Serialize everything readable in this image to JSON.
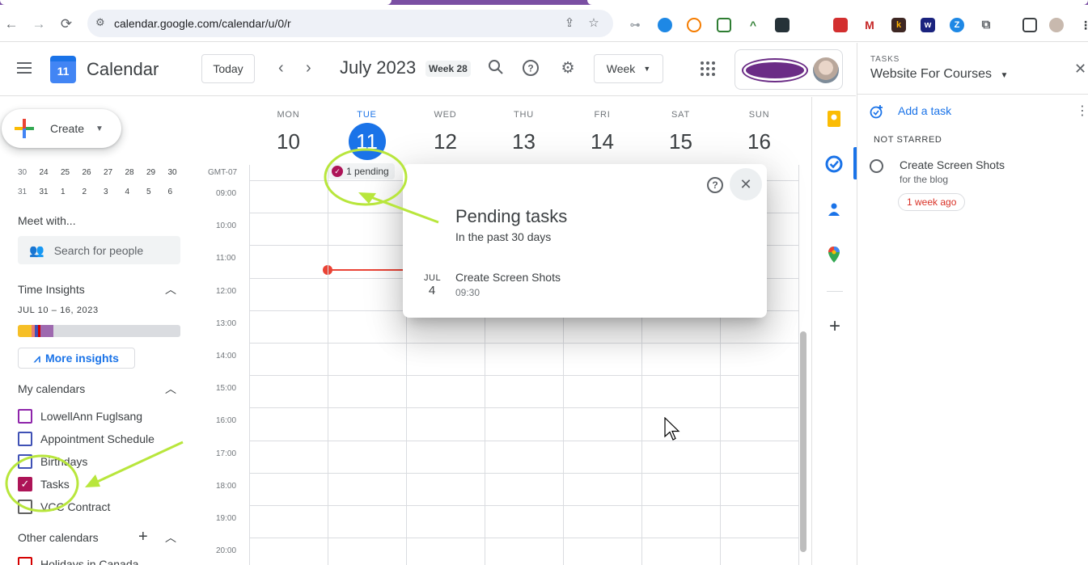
{
  "browser": {
    "url": "calendar.google.com/calendar/u/0/r"
  },
  "header": {
    "app_title": "Calendar",
    "logo_day": "11",
    "today_label": "Today",
    "prev_icon": "chevron-left-icon",
    "next_icon": "chevron-right-icon",
    "month_title": "July 2023",
    "week_badge": "Week 28",
    "view_label": "Week"
  },
  "sidebar": {
    "create_label": "Create",
    "mini_calendar": {
      "rows": [
        [
          "30",
          "24",
          "25",
          "26",
          "27",
          "28",
          "29",
          "30"
        ],
        [
          "31",
          "31",
          "1",
          "2",
          "3",
          "4",
          "5",
          "6"
        ]
      ]
    },
    "meet_with": {
      "title": "Meet with...",
      "search_placeholder": "Search for people"
    },
    "time_insights": {
      "title": "Time Insights",
      "date_range": "JUL 10 – 16, 2023",
      "bar_segments": [
        {
          "color": "#f6bf26",
          "fraction": 0.085
        },
        {
          "color": "#e67c73",
          "fraction": 0.02
        },
        {
          "color": "#3f51b5",
          "fraction": 0.02
        },
        {
          "color": "#d50000",
          "fraction": 0.015
        },
        {
          "color": "#9e69af",
          "fraction": 0.08
        }
      ],
      "more_label": "More insights"
    },
    "my_calendars": {
      "title": "My calendars",
      "items": [
        {
          "label": "LowellAnn Fuglsang",
          "color": "#8e24aa",
          "checked": false
        },
        {
          "label": "Appointment Schedule",
          "color": "#3f51b5",
          "checked": false
        },
        {
          "label": "Birthdays",
          "color": "#3f51b5",
          "checked": false
        },
        {
          "label": "Tasks",
          "color": "#ad1457",
          "checked": true
        },
        {
          "label": "VCC Contract",
          "color": "#616161",
          "checked": false
        }
      ]
    },
    "other_calendars": {
      "title": "Other calendars",
      "items": [
        {
          "label": "Holidays in Canada",
          "color": "#d50000"
        }
      ]
    }
  },
  "week": {
    "timezone": "GMT-07",
    "days": [
      {
        "dow": "MON",
        "num": "10",
        "today": false
      },
      {
        "dow": "TUE",
        "num": "11",
        "today": true
      },
      {
        "dow": "WED",
        "num": "12",
        "today": false
      },
      {
        "dow": "THU",
        "num": "13",
        "today": false
      },
      {
        "dow": "FRI",
        "num": "14",
        "today": false
      },
      {
        "dow": "SAT",
        "num": "15",
        "today": false
      },
      {
        "dow": "SUN",
        "num": "16",
        "today": false
      }
    ],
    "hours": [
      "09:00",
      "10:00",
      "11:00",
      "12:00",
      "13:00",
      "14:00",
      "15:00",
      "16:00",
      "17:00",
      "18:00",
      "19:00",
      "20:00"
    ],
    "pending_chip": "1 pending"
  },
  "popup": {
    "title": "Pending tasks",
    "subtitle": "In the past 30 days",
    "task": {
      "month": "JUL",
      "day": "4",
      "title": "Create Screen Shots",
      "time": "09:30"
    }
  },
  "tasks_panel": {
    "label": "TASKS",
    "list_name": "Website For Courses",
    "add_label": "Add a task",
    "group_label": "NOT STARRED",
    "task": {
      "title": "Create Screen Shots",
      "note": "for the blog",
      "due": "1 week ago"
    }
  },
  "colors": {
    "accent": "#1a73e8",
    "annotation": "#b8e63c",
    "now_line": "#ea4335",
    "tasks": "#ad1457"
  }
}
